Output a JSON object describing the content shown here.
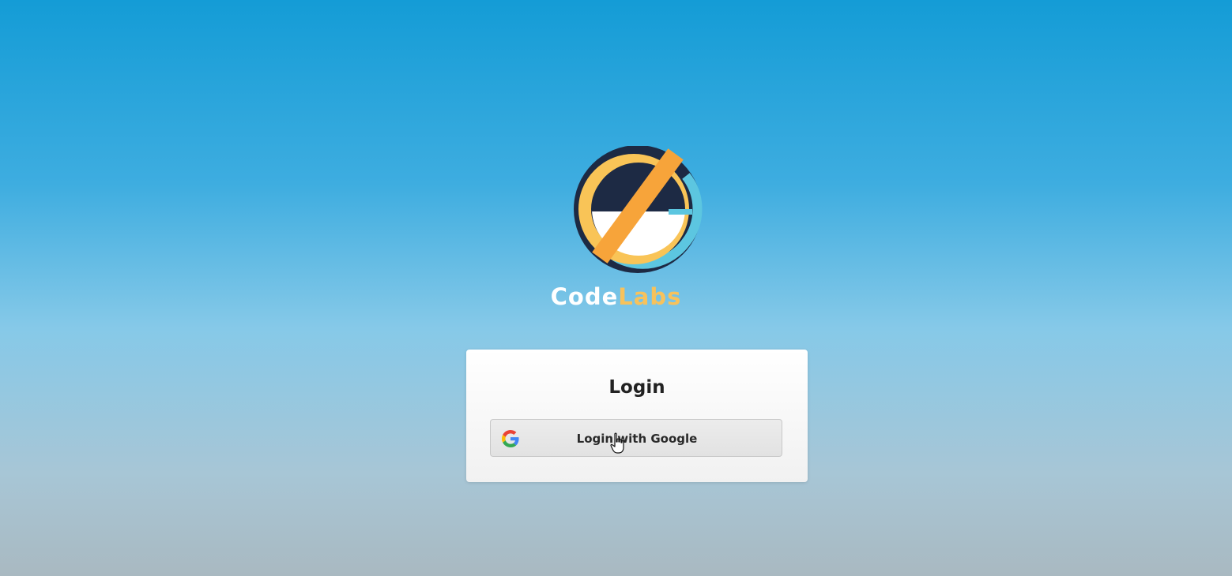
{
  "brand": {
    "name_part1": "Code",
    "name_part2": "Labs",
    "logo_icon": "codelabs-logo-icon",
    "colors": {
      "navy": "#1d2a44",
      "orange": "#f7a43a",
      "yellow": "#f9c457",
      "lightblue": "#5cc6e0",
      "white": "#ffffff"
    }
  },
  "login": {
    "title": "Login",
    "google_button_label": "Login with Google",
    "google_icon": "google-icon"
  },
  "cursor": {
    "icon": "hand-pointer-icon"
  }
}
